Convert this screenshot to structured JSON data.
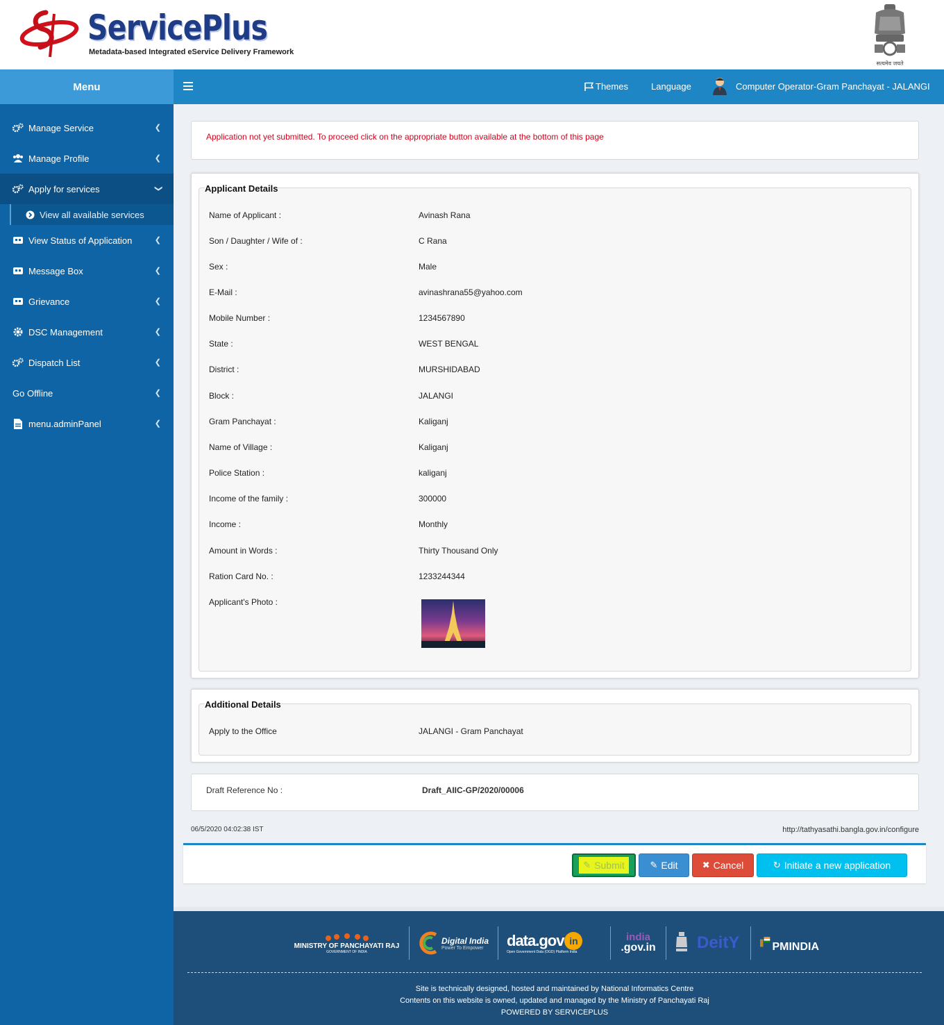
{
  "brand": {
    "title": "ServicePlus",
    "subtitle": "Metadata-based Integrated eService Delivery Framework",
    "emblem_caption": "सत्यमेव जयते"
  },
  "sidebar": {
    "menu_title": "Menu",
    "items": [
      {
        "label": "Manage Service",
        "icon": "gears-icon"
      },
      {
        "label": "Manage Profile",
        "icon": "users-icon"
      },
      {
        "label": "Apply for services",
        "icon": "gears-icon"
      },
      {
        "label": "View Status of Application",
        "icon": "card-icon"
      },
      {
        "label": "Message Box",
        "icon": "card-icon"
      },
      {
        "label": "Grievance",
        "icon": "card-icon"
      },
      {
        "label": "DSC Management",
        "icon": "gear-icon"
      },
      {
        "label": "Dispatch List",
        "icon": "gears-icon"
      },
      {
        "label": "Go Offline",
        "icon": ""
      },
      {
        "label": "menu.adminPanel",
        "icon": "file-icon"
      }
    ],
    "sub_item": "View all available services"
  },
  "navbar": {
    "themes": "Themes",
    "language": "Language",
    "user": "Computer Operator-Gram Panchayat - JALANGI"
  },
  "alert": "Application not yet submitted. To proceed click on the appropriate button available at the bottom of this page",
  "applicant": {
    "legend": "Applicant Details",
    "rows": [
      {
        "label": "Name of Applicant :",
        "value": "Avinash Rana"
      },
      {
        "label": "Son / Daughter / Wife of :",
        "value": "C Rana"
      },
      {
        "label": "Sex :",
        "value": "Male"
      },
      {
        "label": "E-Mail :",
        "value": "avinashrana55@yahoo.com"
      },
      {
        "label": "Mobile Number :",
        "value": "1234567890"
      },
      {
        "label": "State :",
        "value": "WEST BENGAL"
      },
      {
        "label": "District :",
        "value": "MURSHIDABAD"
      },
      {
        "label": "Block :",
        "value": "JALANGI"
      },
      {
        "label": "Gram Panchayat :",
        "value": "Kaliganj"
      },
      {
        "label": "Name of Village :",
        "value": "Kaliganj"
      },
      {
        "label": "Police Station :",
        "value": "kaliganj"
      },
      {
        "label": "Income of the family :",
        "value": "300000"
      },
      {
        "label": "Income :",
        "value": "Monthly"
      },
      {
        "label": "Amount in Words :",
        "value": "Thirty Thousand Only"
      },
      {
        "label": "Ration Card No. :",
        "value": "1233244344"
      },
      {
        "label": "Applicant's Photo :",
        "value": ""
      }
    ]
  },
  "additional": {
    "legend": "Additional Details",
    "label": "Apply to the Office",
    "value": "JALANGI - Gram Panchayat"
  },
  "draft": {
    "label": "Draft Reference No :",
    "value": "Draft_AIIC-GP/2020/00006"
  },
  "meta": {
    "timestamp": "06/5/2020 04:02:38 IST",
    "url": "http://tathyasathi.bangla.gov.in/configure"
  },
  "buttons": {
    "submit": "Submit",
    "edit": "Edit",
    "cancel": "Cancel",
    "initiate": "Initiate a new application"
  },
  "footer": {
    "partners": {
      "panchayati": "MINISTRY OF PANCHAYATI RAJ",
      "panchayati_sub": "GOVERNMENT OF INDIA",
      "digital_india": "Digital India",
      "digital_india_sub": "Power To Empower",
      "datagov": "data.gov",
      "datagov_in": "in",
      "datagov_sub": "Open Government Data (OGD) Platform India",
      "indiagov_1": "india",
      "indiagov_2": ".gov.in",
      "deity": "DeitY",
      "pmindia": "PMINDIA"
    },
    "line1": "Site is technically designed, hosted and maintained by National Informatics Centre",
    "line2": "Contents on this website is owned, updated and managed by the Ministry of Panchayati Raj",
    "line3": "POWERED BY SERVICEPLUS"
  }
}
